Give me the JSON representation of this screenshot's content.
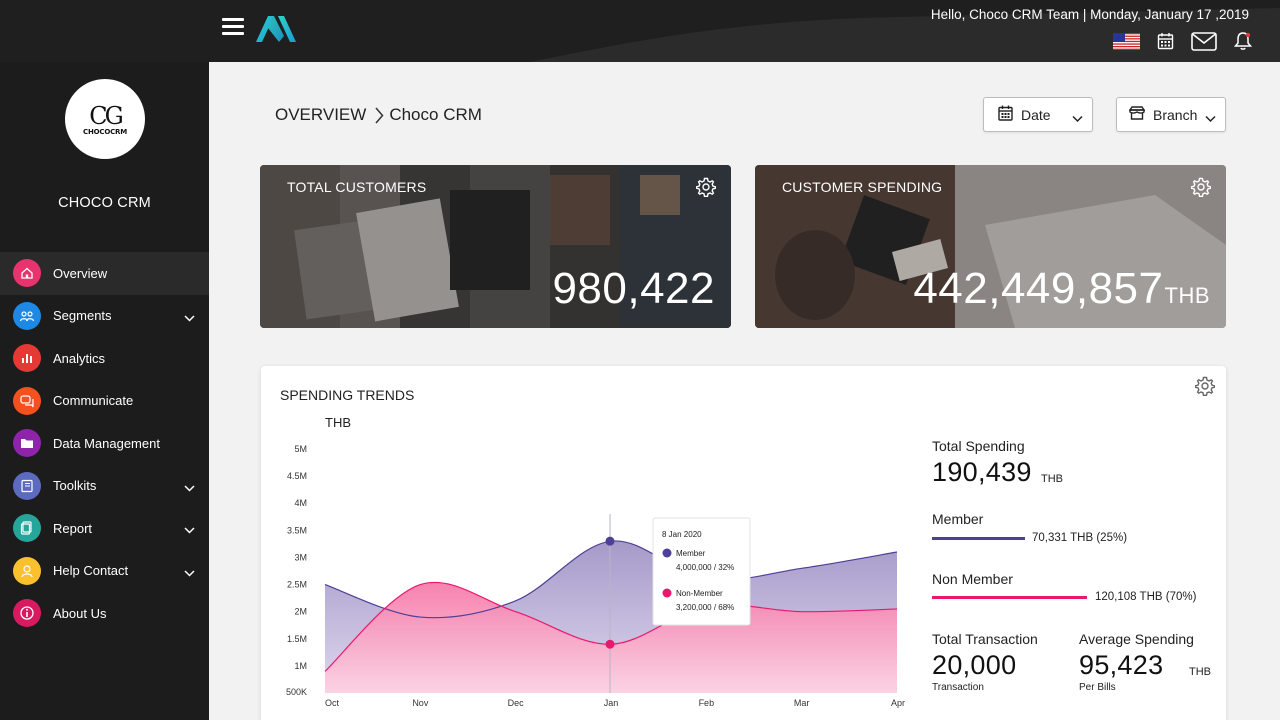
{
  "header": {
    "greeting": "Hello, Choco CRM Team | Monday, January 17 ,2019",
    "icons": [
      "us-flag-icon",
      "calendar-icon",
      "mail-icon",
      "bell-icon"
    ]
  },
  "sidebar": {
    "logo_text": "CG",
    "logo_subtext": "CHOCOCRM",
    "brand_name": "CHOCO CRM",
    "items": [
      {
        "label": "Overview",
        "icon": "home-icon",
        "color": "#e8336e",
        "active": true,
        "chevron": false
      },
      {
        "label": "Segments",
        "icon": "users-icon",
        "color": "#1e88e5",
        "active": false,
        "chevron": true
      },
      {
        "label": "Analytics",
        "icon": "bar-chart-icon",
        "color": "#e53935",
        "active": false,
        "chevron": false
      },
      {
        "label": "Communicate",
        "icon": "chat-icon",
        "color": "#f4511e",
        "active": false,
        "chevron": false
      },
      {
        "label": "Data Management",
        "icon": "folder-icon",
        "color": "#8e24aa",
        "active": false,
        "chevron": false
      },
      {
        "label": "Toolkits",
        "icon": "book-icon",
        "color": "#5c6bc0",
        "active": false,
        "chevron": true
      },
      {
        "label": "Report",
        "icon": "document-icon",
        "color": "#26a69a",
        "active": false,
        "chevron": true
      },
      {
        "label": "Help Contact",
        "icon": "help-icon",
        "color": "#fbc02d",
        "active": false,
        "chevron": true
      },
      {
        "label": "About Us",
        "icon": "info-icon",
        "color": "#d81b60",
        "active": false,
        "chevron": false
      }
    ]
  },
  "breadcrumb": {
    "root": "OVERVIEW",
    "current": "Choco CRM"
  },
  "filters": {
    "date_label": "Date",
    "branch_label": "Branch"
  },
  "kpis": {
    "total_customers": {
      "title": "TOTAL CUSTOMERS",
      "value": "980,422"
    },
    "customer_spending": {
      "title": "CUSTOMER SPENDING",
      "value": "442,449,857",
      "unit": "THB"
    }
  },
  "trends": {
    "title": "SPENDING TRENDS",
    "tooltip": {
      "date": "8 Jan 2020",
      "member_label": "Member",
      "member_value": "4,000,000 / 32%",
      "nonmember_label": "Non-Member",
      "nonmember_value": "3,200,000 / 68%"
    },
    "stats": {
      "total_spending_label": "Total Spending",
      "total_spending_value": "190,439",
      "total_spending_unit": "THB",
      "member_label": "Member",
      "member_value": "70,331 THB (25%)",
      "member_fraction": 0.25,
      "nonmember_label": "Non Member",
      "nonmember_value": "120,108 THB (70%)",
      "nonmember_fraction": 0.7,
      "total_transaction_label": "Total Transaction",
      "total_transaction_value": "20,000",
      "total_transaction_sub": "Transaction",
      "avg_spending_label": "Average Spending",
      "avg_spending_value": "95,423",
      "avg_spending_unit": "THB",
      "avg_spending_sub": "Per Bills"
    }
  },
  "colors": {
    "member": "#4e3f97",
    "member_fill": "#a699c9",
    "nonmember": "#e8196d",
    "nonmember_fill": "#f67bab",
    "sidebar_bg": "#1c1c1c",
    "topbar_bg": "#1f1f1f"
  },
  "chart_data": {
    "type": "area",
    "ylabel": "THB",
    "x": [
      "Oct",
      "Nov",
      "Dec",
      "Jan",
      "Feb",
      "Mar",
      "Apr"
    ],
    "y_ticks": [
      "5M",
      "4.5M",
      "4M",
      "3.5M",
      "3M",
      "2.5M",
      "2M",
      "1.5M",
      "1M",
      "500K"
    ],
    "ylim": [
      500000,
      5000000
    ],
    "series": [
      {
        "name": "Member",
        "values": [
          2500000,
          1900000,
          2200000,
          3300000,
          2600000,
          2800000,
          3100000
        ]
      },
      {
        "name": "Non-Member",
        "values": [
          900000,
          2500000,
          2000000,
          1400000,
          2100000,
          2000000,
          2050000
        ]
      }
    ],
    "highlight": {
      "x": "8 Jan 2020",
      "member": 3300000,
      "nonmember": 1400000
    },
    "grid": false
  }
}
